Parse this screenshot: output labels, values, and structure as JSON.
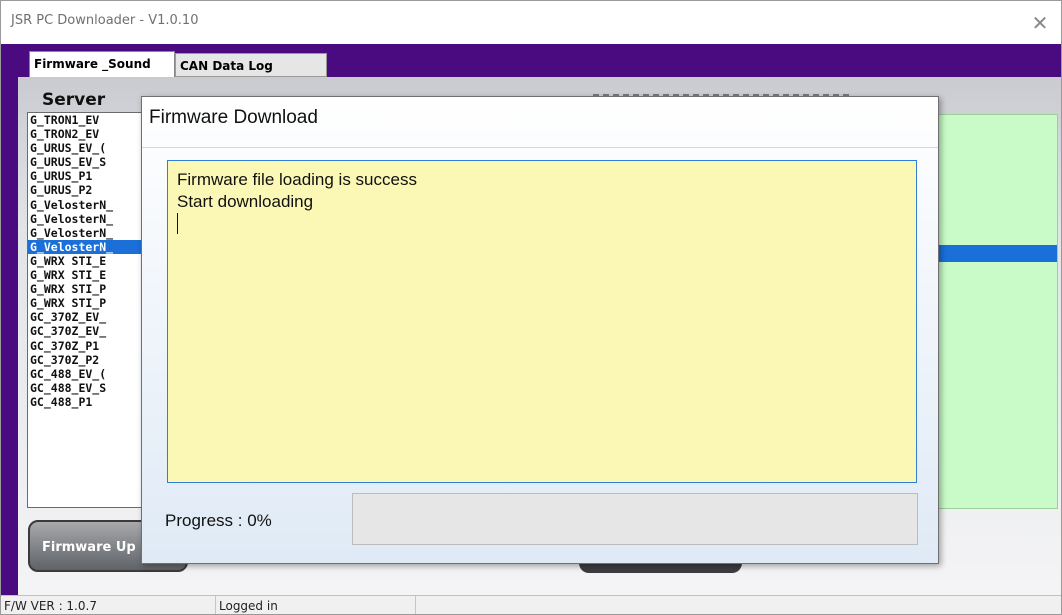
{
  "window": {
    "title": "JSR PC Downloader - V1.0.10",
    "close_glyph": "✕"
  },
  "tabs": [
    {
      "label": "Firmware _Sound",
      "active": true
    },
    {
      "label": "CAN Data Log",
      "active": false
    }
  ],
  "server": {
    "label": "Server",
    "items": [
      "G_TRON1_EV",
      "G_TRON2_EV",
      "G_URUS_EV_(",
      "G_URUS_EV_S",
      "G_URUS_P1",
      "G_URUS_P2",
      "G_VelosterN_",
      "G_VelosterN_",
      "G_VelosterN_",
      "G_VelosterN_",
      "G_WRX STI_E",
      "G_WRX STI_E",
      "G_WRX STI_P",
      "G_WRX STI_P",
      "GC_370Z_EV_",
      "GC_370Z_EV_",
      "GC_370Z_P1",
      "GC_370Z_P2",
      "GC_488_EV_(",
      "GC_488_EV_S",
      "GC_488_P1"
    ],
    "selected_index": 9
  },
  "firmware_update_button": "Firmware Up",
  "dialog": {
    "title": "Firmware Download",
    "log_lines": [
      "Firmware file loading is success",
      "Start downloading"
    ],
    "progress_label": "Progress : 0%",
    "progress_fraction": 0
  },
  "status": {
    "fw_version": "F/W VER : 1.0.7",
    "login_status": "Logged in"
  },
  "colors": {
    "frame": "#4a0a80",
    "selection": "#1a6fd9",
    "log_bg": "#fbf7b4",
    "right_panel": "#c8fbc8"
  }
}
